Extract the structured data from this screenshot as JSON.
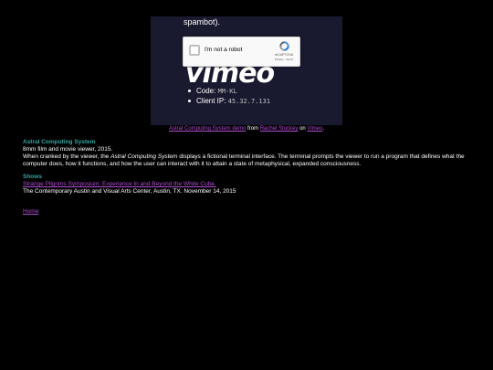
{
  "video": {
    "cut_text": "spambot).",
    "recaptcha": {
      "label": "I'm not a robot",
      "brand": "reCAPTCHA",
      "links": "Privacy - Terms"
    },
    "logo_text": "vimeo",
    "info": [
      {
        "label": "Code:",
        "value": "MM-KL"
      },
      {
        "label": "Client IP:",
        "value": "45.32.7.131"
      }
    ]
  },
  "caption": {
    "video_link": "Astral Computing System demo",
    "from": "from",
    "author_link": "Rachel Stuckey",
    "on": "on",
    "platform_link": "Vimeo",
    "end": "."
  },
  "description": {
    "title": "Astral Computing System",
    "line1": "8mm film and movie viewer, 2015.",
    "line2_a": "When cranked by the viewer, the",
    "line2_em": "Astral Computing System",
    "line2_b": "displays a fictional terminal interface. The terminal prompts the viewer to run a program that defines what the computer does, how it functions, and how the user can interact with it to attain a state of metaphysical, expanded consciousness."
  },
  "shows": {
    "heading": "Shows",
    "link": "Strange Pilgrims Symposium: Experience In and Beyond the White Cube.",
    "detail": "The Contemporary Austin and Visual Arts Center, Austin, TX. November 14, 2015"
  },
  "footer": {
    "home": "Home"
  },
  "colors": {
    "background": "#000000",
    "title": "#2fa6a0",
    "link": "#b04bd2",
    "video_bg": "#191930"
  }
}
